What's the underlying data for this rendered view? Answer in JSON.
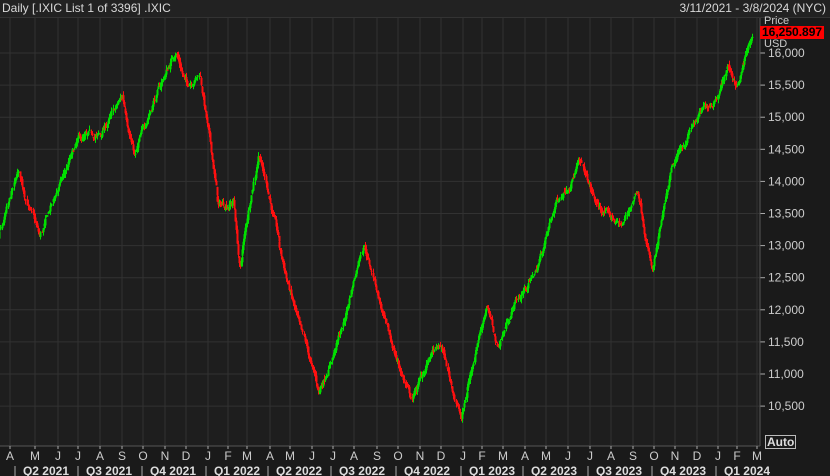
{
  "header": {
    "title": "Daily [.IXIC List 1 of 3396] .IXIC",
    "date_range": "3/11/2021 - 3/8/2024 (NYC)"
  },
  "axis": {
    "price_label": "Price",
    "currency_label": "USD",
    "last_price": "16,250.897",
    "y_ticks": [
      {
        "value": 16000,
        "label": "16,000"
      },
      {
        "value": 15500,
        "label": "15,500"
      },
      {
        "value": 15000,
        "label": "15,000"
      },
      {
        "value": 14500,
        "label": "14,500"
      },
      {
        "value": 14000,
        "label": "14,000"
      },
      {
        "value": 13500,
        "label": "13,500"
      },
      {
        "value": 13000,
        "label": "13,000"
      },
      {
        "value": 12500,
        "label": "12,500"
      },
      {
        "value": 12000,
        "label": "12,000"
      },
      {
        "value": 11500,
        "label": "11,500"
      },
      {
        "value": 11000,
        "label": "11,000"
      },
      {
        "value": 10500,
        "label": "10,500"
      }
    ],
    "months": [
      "A",
      "M",
      "J",
      "J",
      "A",
      "S",
      "O",
      "N",
      "D",
      "J",
      "F",
      "M",
      "A",
      "M",
      "J",
      "J",
      "A",
      "S",
      "O",
      "N",
      "D",
      "J",
      "F",
      "M",
      "A",
      "M",
      "J",
      "J",
      "A",
      "S",
      "O",
      "N",
      "D",
      "J",
      "F",
      "M"
    ],
    "quarters": [
      "Q2 2021",
      "Q3 2021",
      "Q4 2021",
      "Q1 2022",
      "Q2 2022",
      "Q3 2022",
      "Q4 2022",
      "Q1 2023",
      "Q2 2023",
      "Q3 2023",
      "Q4 2023",
      "Q1 2024"
    ],
    "auto_label": "Auto"
  },
  "colors": {
    "up": "#00e000",
    "down": "#ff1010",
    "grid": "#323232",
    "bg": "#1e1e1e"
  },
  "chart_data": {
    "type": "candlestick",
    "ylim": [
      10100,
      16400
    ],
    "x_months_start": "2021-03",
    "path_by_month": [
      [
        0,
        13300
      ],
      [
        0.5,
        13000
      ],
      [
        1.3,
        14100
      ],
      [
        2.2,
        13100
      ],
      [
        3,
        13900
      ],
      [
        4,
        14600
      ],
      [
        5,
        14700
      ],
      [
        6,
        15300
      ],
      [
        6.6,
        14400
      ],
      [
        7.5,
        15300
      ],
      [
        8.5,
        16050
      ],
      [
        9,
        15500
      ],
      [
        9.6,
        15700
      ],
      [
        10.5,
        13600
      ],
      [
        11.3,
        13700
      ],
      [
        11.6,
        12600
      ],
      [
        12.5,
        14500
      ],
      [
        13.5,
        12900
      ],
      [
        14.5,
        11600
      ],
      [
        15.3,
        10700
      ],
      [
        16.5,
        11800
      ],
      [
        17.4,
        13100
      ],
      [
        18.5,
        11600
      ],
      [
        19.6,
        10600
      ],
      [
        20.5,
        11300
      ],
      [
        21,
        11400
      ],
      [
        21.9,
        10300
      ],
      [
        22.5,
        11200
      ],
      [
        23.2,
        12100
      ],
      [
        23.7,
        11400
      ],
      [
        24.5,
        12100
      ],
      [
        25.5,
        12600
      ],
      [
        26.5,
        13700
      ],
      [
        27.5,
        14300
      ],
      [
        28.3,
        13600
      ],
      [
        29.5,
        13300
      ],
      [
        30.2,
        13900
      ],
      [
        30.9,
        12600
      ],
      [
        31.8,
        14100
      ],
      [
        32.8,
        14900
      ],
      [
        33.8,
        15300
      ],
      [
        34.5,
        15800
      ],
      [
        35,
        15500
      ],
      [
        35.8,
        16300
      ]
    ],
    "last_close": 16250.897
  }
}
